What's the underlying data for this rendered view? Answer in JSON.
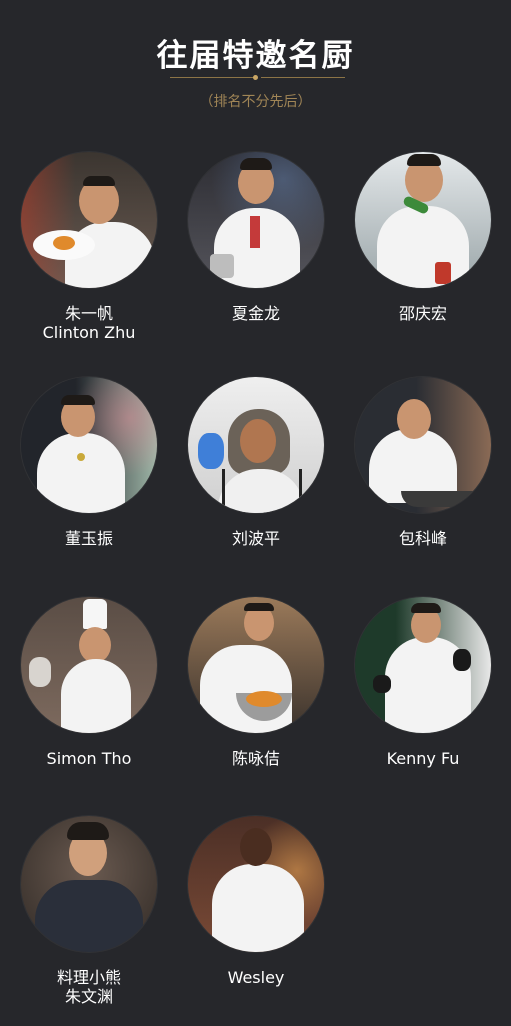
{
  "header": {
    "title": "往届特邀名厨",
    "subtitle": "（排名不分先后）"
  },
  "chefs": [
    {
      "name_line1": "朱一帆",
      "name_line2": "Clinton Zhu"
    },
    {
      "name_line1": "夏金龙",
      "name_line2": ""
    },
    {
      "name_line1": "邵庆宏",
      "name_line2": ""
    },
    {
      "name_line1": "董玉振",
      "name_line2": ""
    },
    {
      "name_line1": "刘波平",
      "name_line2": ""
    },
    {
      "name_line1": "包科峰",
      "name_line2": ""
    },
    {
      "name_line1": "Simon Tho",
      "name_line2": ""
    },
    {
      "name_line1": "陈咏佶",
      "name_line2": ""
    },
    {
      "name_line1": "Kenny Fu",
      "name_line2": ""
    },
    {
      "name_line1": "料理小熊",
      "name_line2": "朱文渊"
    },
    {
      "name_line1": "Wesley",
      "name_line2": ""
    }
  ],
  "colors": {
    "background": "#26272b",
    "accent_gold": "#c9a665",
    "subtitle_gold": "#a08556"
  }
}
